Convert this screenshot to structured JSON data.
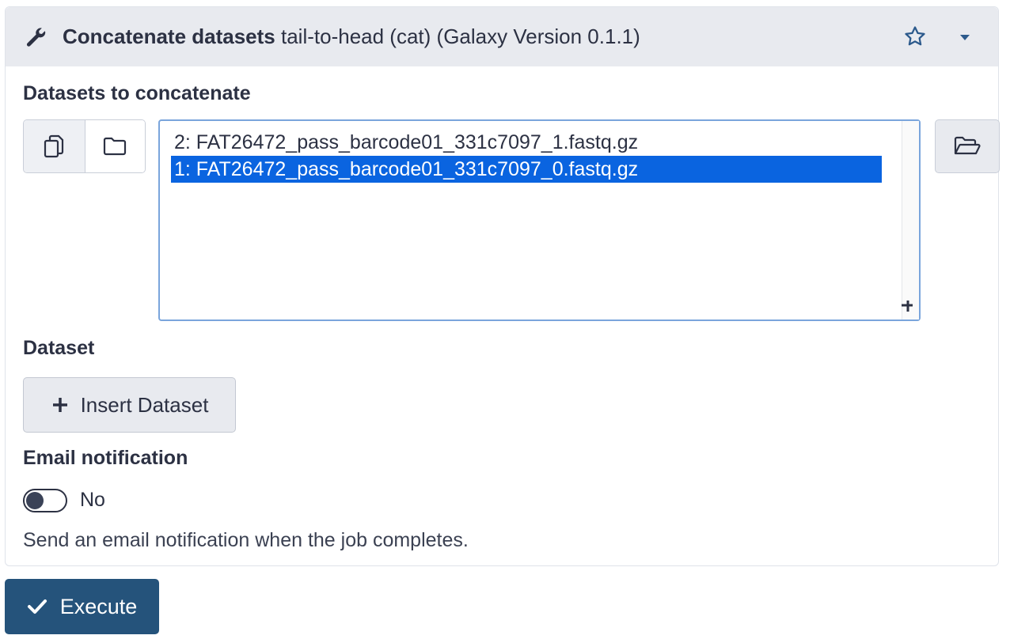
{
  "header": {
    "tool_name": "Concatenate datasets",
    "tool_subtitle": "tail-to-head (cat)",
    "version": "(Galaxy Version 0.1.1)",
    "icons": [
      "wrench-icon",
      "star-icon",
      "caret-down-icon"
    ]
  },
  "datasets_field": {
    "label": "Datasets to concatenate",
    "mode_buttons": [
      "multiple-datasets-icon",
      "collection-folder-icon"
    ],
    "options": [
      {
        "text": "2: FAT26472_pass_barcode01_331c7097_1.fastq.gz",
        "selected": false
      },
      {
        "text": "1: FAT26472_pass_barcode01_331c7097_0.fastq.gz",
        "selected": true
      }
    ],
    "browse_icon": "folder-open-icon"
  },
  "dataset_repeat": {
    "label": "Dataset",
    "insert_button": "Insert Dataset"
  },
  "email": {
    "label": "Email notification",
    "toggle_value": "No",
    "help": "Send an email notification when the job completes."
  },
  "actions": {
    "execute_label": "Execute"
  },
  "colors": {
    "header_bg": "#e8eaef",
    "selected_bg": "#0a64e0",
    "execute_bg": "#25537b",
    "focus_border": "#7aa5dc"
  }
}
